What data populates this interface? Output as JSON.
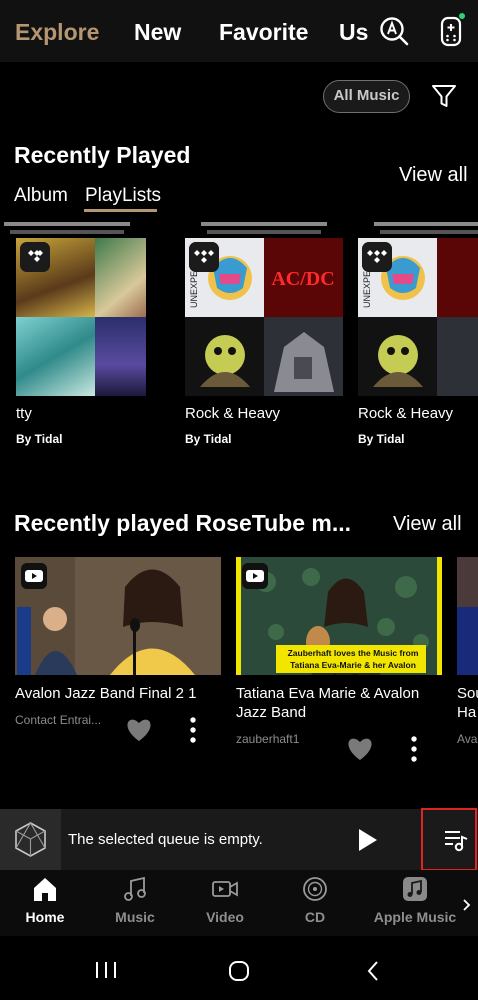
{
  "top_tabs": [
    {
      "label": "Explore",
      "active": true
    },
    {
      "label": "New",
      "active": false
    },
    {
      "label": "Favorite",
      "active": false
    },
    {
      "label": "Us",
      "active": false
    }
  ],
  "top_icons": {
    "search": "search-a-icon",
    "remote": "remote-icon"
  },
  "filter": {
    "chip_label": "All Music",
    "icon": "filter-icon"
  },
  "recently_played": {
    "title": "Recently Played",
    "view_all": "View all",
    "subtabs": [
      {
        "label": "Album",
        "selected": false
      },
      {
        "label": "PlayLists",
        "selected": true
      }
    ],
    "items": [
      {
        "title": "tty",
        "by": "By Tidal"
      },
      {
        "title": "Rock & Heavy",
        "by": "By Tidal"
      },
      {
        "title": "Rock & Heavy",
        "by": "By Tidal"
      }
    ]
  },
  "rosetube": {
    "title": "Recently played RoseTube m...",
    "view_all": "View all",
    "items": [
      {
        "title": "Avalon Jazz Band Final 2 1",
        "channel": "Contact Entrai..."
      },
      {
        "title": "Tatiana Eva Marie & Avalon Jazz Band",
        "channel": "zauberhaft1",
        "thumb_caption": "Zauberhaft loves the Music from Tatiana Eva-Marie & her Avalon Jazz Band"
      },
      {
        "title": "Sou Ha",
        "channel": "Ava"
      }
    ]
  },
  "mini_player": {
    "message": "The selected queue is empty."
  },
  "album_art_text": {
    "acdc": "AC/DC",
    "unexpected": "UNEXPE"
  },
  "bottom_nav": [
    {
      "label": "Home",
      "active": true
    },
    {
      "label": "Music",
      "active": false
    },
    {
      "label": "Video",
      "active": false
    },
    {
      "label": "CD",
      "active": false
    },
    {
      "label": "Apple Music",
      "active": false
    }
  ],
  "colors": {
    "accent": "#b49672",
    "highlight_box": "#e02424",
    "status_dot": "#2bd27a"
  }
}
